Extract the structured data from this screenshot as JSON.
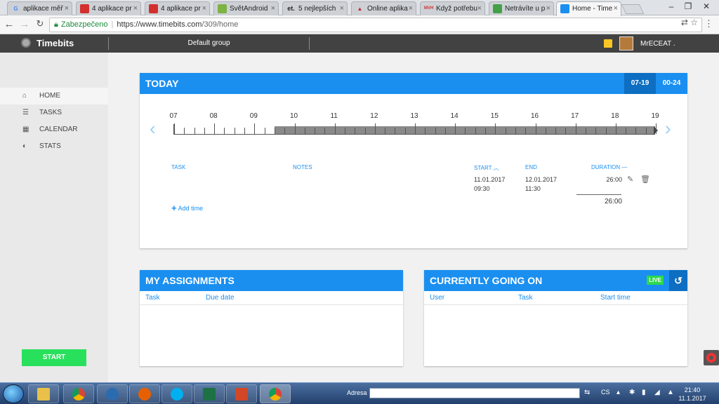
{
  "browser": {
    "tabs": [
      {
        "title": "aplikace měř",
        "fav": "G",
        "color": "#ffffff"
      },
      {
        "title": "4 aplikace pr",
        "fav": "živě",
        "color": "#d32f2f"
      },
      {
        "title": "4 aplikace pr",
        "fav": "živě",
        "color": "#d32f2f"
      },
      {
        "title": "SvětAndroid",
        "fav": "",
        "color": "#7cb342"
      },
      {
        "title": "5 nejlepších",
        "fav": "et.",
        "color": "#ffffff"
      },
      {
        "title": "Online aplika",
        "fav": "",
        "color": "#c62828"
      },
      {
        "title": "Když potřebu",
        "fav": "MVH",
        "color": "#ffffff"
      },
      {
        "title": "Netrávíte u p",
        "fav": "",
        "color": "#43a047"
      },
      {
        "title": "Home - Time",
        "fav": "",
        "color": "#1a8ff0"
      }
    ],
    "secure_label": "Zabezpečeno",
    "url_host": "https://www.timebits.com",
    "url_path": "/309/home"
  },
  "app": {
    "logo": "Timebits",
    "group": "Default group",
    "username": "MrECEAT ."
  },
  "sidebar": {
    "items": [
      {
        "label": "HOME",
        "icon": "home-icon",
        "glyph": "⌂"
      },
      {
        "label": "TASKS",
        "icon": "list-icon",
        "glyph": "☰"
      },
      {
        "label": "CALENDAR",
        "icon": "calendar-icon",
        "glyph": "▦"
      },
      {
        "label": "STATS",
        "icon": "pie-chart-icon",
        "glyph": "◐"
      }
    ],
    "start_label": "START"
  },
  "today": {
    "title": "TODAY",
    "range1": "07-19",
    "range2": "00-24",
    "hours": [
      "07",
      "08",
      "09",
      "10",
      "11",
      "12",
      "13",
      "14",
      "15",
      "16",
      "17",
      "18",
      "19"
    ],
    "filled_from_hour": 9.5,
    "columns": {
      "task": "TASK",
      "notes": "NOTES",
      "start": "START",
      "end": "END",
      "duration": "DURATION"
    },
    "entry": {
      "start_date": "11.01.2017",
      "start_time": "09:30",
      "end_date": "12.01.2017",
      "end_time": "11:30",
      "duration": "26:00"
    },
    "total": "26:00",
    "add_time": "Add time"
  },
  "assignments": {
    "title": "MY ASSIGNMENTS",
    "col_task": "Task",
    "col_due": "Due date"
  },
  "going": {
    "title": "CURRENTLY GOING ON",
    "live": "LIVE",
    "col_user": "User",
    "col_task": "Task",
    "col_start": "Start time"
  },
  "taskbar": {
    "address_label": "Adresa",
    "lang": "CS",
    "time": "21:40",
    "date": "11.1.2017"
  }
}
